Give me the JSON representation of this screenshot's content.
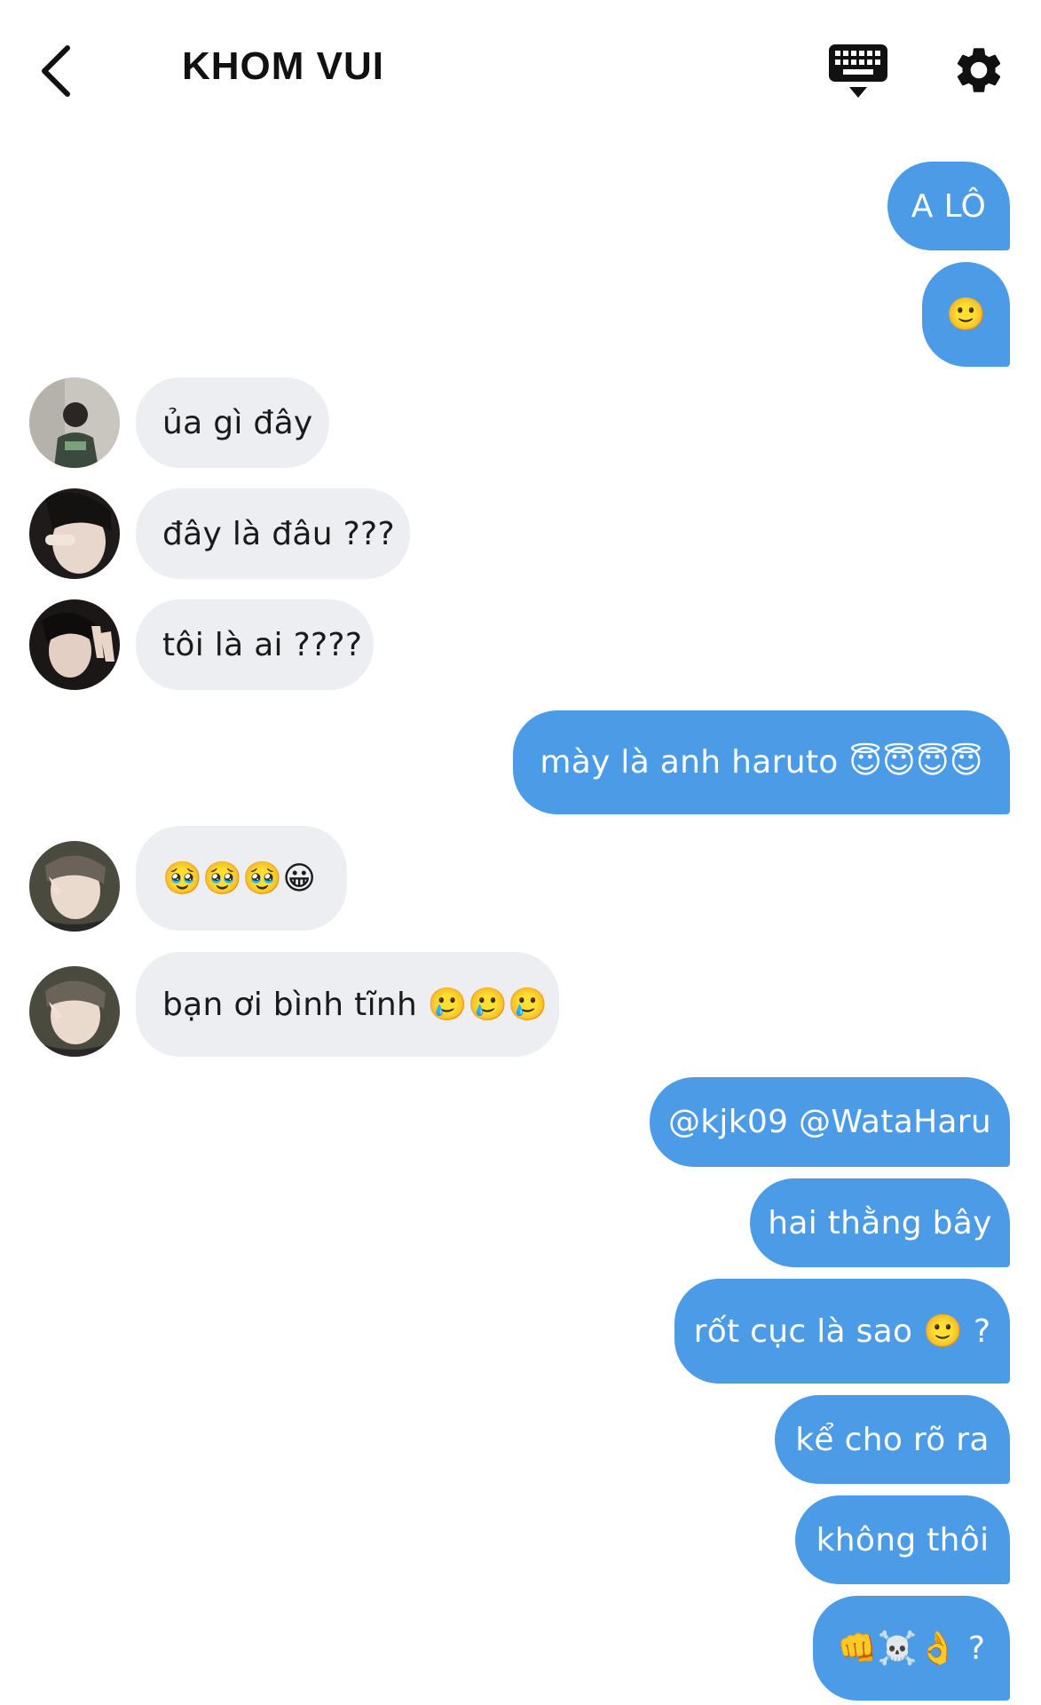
{
  "header": {
    "title": "KHOM VUI",
    "back_icon": "chevron-left-icon",
    "keyboard_icon": "keyboard-hide-icon",
    "settings_icon": "gear-icon"
  },
  "colors": {
    "outgoing_bubble": "#4b9be6",
    "incoming_bubble": "#eceef1",
    "text_dark": "#111111"
  },
  "messages": [
    {
      "id": "m1",
      "from": "me",
      "text": "A LÔ"
    },
    {
      "id": "m2",
      "from": "me",
      "text": "🙂"
    },
    {
      "id": "m3",
      "from": "other",
      "text": "ủa gì đây"
    },
    {
      "id": "m4",
      "from": "other",
      "text": "đây là đâu ???"
    },
    {
      "id": "m5",
      "from": "other",
      "text": "tôi là ai ????"
    },
    {
      "id": "m6",
      "from": "me",
      "text": "mày là anh haruto 😇😇😇😇"
    },
    {
      "id": "m7",
      "from": "other",
      "text": "🥹🥹🥹😀"
    },
    {
      "id": "m8",
      "from": "other",
      "text": "bạn ơi bình tĩnh 🥲🥲🥲"
    },
    {
      "id": "m9",
      "from": "me",
      "text": "@kjk09 @WataHaru"
    },
    {
      "id": "m10",
      "from": "me",
      "text": "hai thằng bây"
    },
    {
      "id": "m11",
      "from": "me",
      "text": "rốt cục là sao 🙂 ?"
    },
    {
      "id": "m12",
      "from": "me",
      "text": "kể cho rõ ra"
    },
    {
      "id": "m13",
      "from": "me",
      "text": "không thôi"
    },
    {
      "id": "m14",
      "from": "me",
      "text": "👊☠️👌 ?"
    }
  ]
}
